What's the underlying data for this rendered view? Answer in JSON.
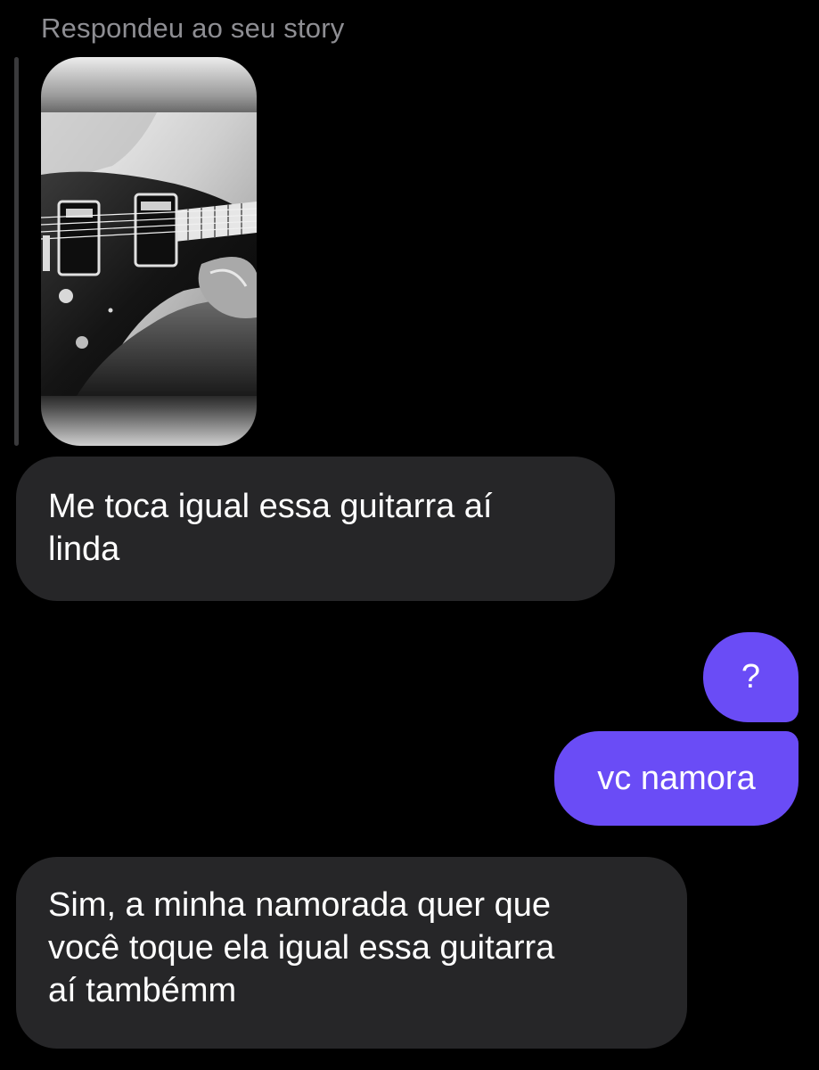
{
  "reply_header": "Respondeu ao seu story",
  "story": {
    "image_alt": "Foto em preto e branco de uma guitarra elétrica"
  },
  "messages": [
    {
      "direction": "incoming",
      "text": "Me toca igual essa guitarra aí\nlinda"
    },
    {
      "direction": "outgoing",
      "text": "?"
    },
    {
      "direction": "outgoing",
      "text": "vc namora"
    },
    {
      "direction": "incoming",
      "text": "Sim, a minha namorada quer que\nvocê toque ela igual essa guitarra\naí tambémm"
    }
  ],
  "colors": {
    "background": "#000000",
    "incoming_bubble": "#262628",
    "outgoing_bubble": "#6a4cf6",
    "secondary_text": "#8e8e93"
  }
}
